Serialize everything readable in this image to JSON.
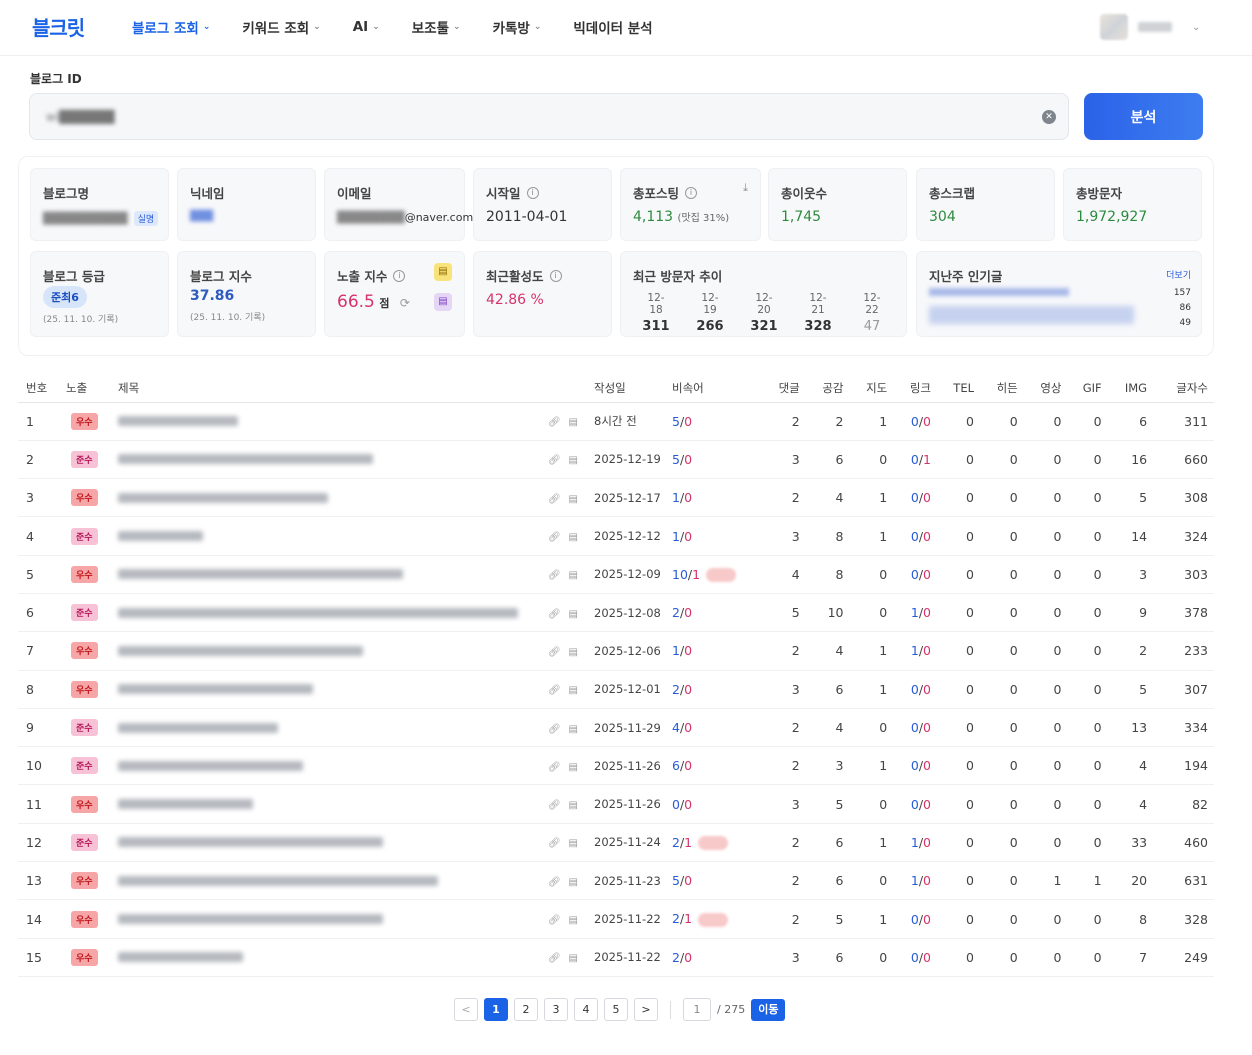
{
  "header": {
    "logo": "블크릿",
    "nav": [
      {
        "label": "블로그 조회",
        "active": true
      },
      {
        "label": "키워드 조회"
      },
      {
        "label": "AI"
      },
      {
        "label": "보조툴"
      },
      {
        "label": "카톡방"
      },
      {
        "label": "빅데이터 분석"
      }
    ]
  },
  "search": {
    "label": "블로그 ID",
    "value": "wi██████",
    "button": "분석"
  },
  "stats": {
    "blog_name": {
      "title": "블로그명",
      "badge": "실명"
    },
    "nickname": {
      "title": "닉네임"
    },
    "email": {
      "title": "이메일",
      "suffix": "@naver.com"
    },
    "start_date": {
      "title": "시작일",
      "value": "2011-04-01"
    },
    "total_posts": {
      "title": "총포스팅",
      "value": "4,113",
      "note": "(맛집 31%)"
    },
    "neighbors": {
      "title": "총이웃수",
      "value": "1,745"
    },
    "scraps": {
      "title": "총스크랩",
      "value": "304"
    },
    "visitors": {
      "title": "총방문자",
      "value": "1,972,927"
    },
    "grade": {
      "title": "블로그 등급",
      "value": "준최6",
      "date": "(25. 11. 10. 기록)"
    },
    "index": {
      "title": "블로그 지수",
      "value": "37.86",
      "date": "(25. 11. 10. 기록)"
    },
    "exposure": {
      "title": "노출 지수",
      "value": "66.5",
      "unit": "점"
    },
    "activity": {
      "title": "최근활성도",
      "value": "42.86 %"
    },
    "recent_visitors": {
      "title": "최근 방문자 추이",
      "days": [
        {
          "date": "12-18",
          "count": "311"
        },
        {
          "date": "12-19",
          "count": "266"
        },
        {
          "date": "12-20",
          "count": "321"
        },
        {
          "date": "12-21",
          "count": "328"
        },
        {
          "date": "12-22",
          "count": "47"
        }
      ]
    },
    "popular": {
      "title": "지난주 인기글",
      "more": "더보기",
      "nums": [
        "157",
        "86",
        "49"
      ]
    }
  },
  "table": {
    "headers": [
      "번호",
      "노출",
      "제목",
      "작성일",
      "비속어",
      "댓글",
      "공감",
      "지도",
      "링크",
      "TEL",
      "히든",
      "영상",
      "GIF",
      "IMG",
      "글자수"
    ],
    "rows": [
      {
        "no": "1",
        "tag": "우수",
        "tw": 120,
        "date": "8시간 전",
        "kwa": "5",
        "kwb": "0",
        "pill": false,
        "c": "2",
        "l": "2",
        "m": "1",
        "la": "0",
        "lb": "0",
        "tel": "0",
        "h": "0",
        "v": "0",
        "g": "0",
        "img": "6",
        "len": "311"
      },
      {
        "no": "2",
        "tag": "준수",
        "tw": 255,
        "date": "2025-12-19",
        "kwa": "5",
        "kwb": "0",
        "pill": false,
        "c": "3",
        "l": "6",
        "m": "0",
        "la": "0",
        "lb": "1",
        "tel": "0",
        "h": "0",
        "v": "0",
        "g": "0",
        "img": "16",
        "len": "660"
      },
      {
        "no": "3",
        "tag": "우수",
        "tw": 210,
        "date": "2025-12-17",
        "kwa": "1",
        "kwb": "0",
        "pill": false,
        "c": "2",
        "l": "4",
        "m": "1",
        "la": "0",
        "lb": "0",
        "tel": "0",
        "h": "0",
        "v": "0",
        "g": "0",
        "img": "5",
        "len": "308"
      },
      {
        "no": "4",
        "tag": "준수",
        "tw": 85,
        "date": "2025-12-12",
        "kwa": "1",
        "kwb": "0",
        "pill": false,
        "c": "3",
        "l": "8",
        "m": "1",
        "la": "0",
        "lb": "0",
        "tel": "0",
        "h": "0",
        "v": "0",
        "g": "0",
        "img": "14",
        "len": "324"
      },
      {
        "no": "5",
        "tag": "우수",
        "tw": 285,
        "date": "2025-12-09",
        "kwa": "10",
        "kwb": "1",
        "pill": true,
        "c": "4",
        "l": "8",
        "m": "0",
        "la": "0",
        "lb": "0",
        "tel": "0",
        "h": "0",
        "v": "0",
        "g": "0",
        "img": "3",
        "len": "303"
      },
      {
        "no": "6",
        "tag": "준수",
        "tw": 400,
        "date": "2025-12-08",
        "kwa": "2",
        "kwb": "0",
        "pill": false,
        "c": "5",
        "l": "10",
        "m": "0",
        "la": "1",
        "lb": "0",
        "tel": "0",
        "h": "0",
        "v": "0",
        "g": "0",
        "img": "9",
        "len": "378"
      },
      {
        "no": "7",
        "tag": "우수",
        "tw": 245,
        "date": "2025-12-06",
        "kwa": "1",
        "kwb": "0",
        "pill": false,
        "c": "2",
        "l": "4",
        "m": "1",
        "la": "1",
        "lb": "0",
        "tel": "0",
        "h": "0",
        "v": "0",
        "g": "0",
        "img": "2",
        "len": "233"
      },
      {
        "no": "8",
        "tag": "우수",
        "tw": 195,
        "date": "2025-12-01",
        "kwa": "2",
        "kwb": "0",
        "pill": false,
        "c": "3",
        "l": "6",
        "m": "1",
        "la": "0",
        "lb": "0",
        "tel": "0",
        "h": "0",
        "v": "0",
        "g": "0",
        "img": "5",
        "len": "307"
      },
      {
        "no": "9",
        "tag": "준수",
        "tw": 160,
        "date": "2025-11-29",
        "kwa": "4",
        "kwb": "0",
        "pill": false,
        "c": "2",
        "l": "4",
        "m": "0",
        "la": "0",
        "lb": "0",
        "tel": "0",
        "h": "0",
        "v": "0",
        "g": "0",
        "img": "13",
        "len": "334"
      },
      {
        "no": "10",
        "tag": "준수",
        "tw": 185,
        "date": "2025-11-26",
        "kwa": "6",
        "kwb": "0",
        "pill": false,
        "c": "2",
        "l": "3",
        "m": "1",
        "la": "0",
        "lb": "0",
        "tel": "0",
        "h": "0",
        "v": "0",
        "g": "0",
        "img": "4",
        "len": "194"
      },
      {
        "no": "11",
        "tag": "우수",
        "tw": 135,
        "date": "2025-11-26",
        "kwa": "0",
        "kwb": "0",
        "pill": false,
        "c": "3",
        "l": "5",
        "m": "0",
        "la": "0",
        "lb": "0",
        "tel": "0",
        "h": "0",
        "v": "0",
        "g": "0",
        "img": "4",
        "len": "82"
      },
      {
        "no": "12",
        "tag": "준수",
        "tw": 265,
        "date": "2025-11-24",
        "kwa": "2",
        "kwb": "1",
        "pill": true,
        "c": "2",
        "l": "6",
        "m": "1",
        "la": "1",
        "lb": "0",
        "tel": "0",
        "h": "0",
        "v": "0",
        "g": "0",
        "img": "33",
        "len": "460"
      },
      {
        "no": "13",
        "tag": "우수",
        "tw": 320,
        "date": "2025-11-23",
        "kwa": "5",
        "kwb": "0",
        "pill": false,
        "c": "2",
        "l": "6",
        "m": "0",
        "la": "1",
        "lb": "0",
        "tel": "0",
        "h": "0",
        "v": "1",
        "g": "1",
        "img": "20",
        "len": "631"
      },
      {
        "no": "14",
        "tag": "우수",
        "tw": 265,
        "date": "2025-11-22",
        "kwa": "2",
        "kwb": "1",
        "pill": true,
        "c": "2",
        "l": "5",
        "m": "1",
        "la": "0",
        "lb": "0",
        "tel": "0",
        "h": "0",
        "v": "0",
        "g": "0",
        "img": "8",
        "len": "328"
      },
      {
        "no": "15",
        "tag": "우수",
        "tw": 125,
        "date": "2025-11-22",
        "kwa": "2",
        "kwb": "0",
        "pill": false,
        "c": "3",
        "l": "6",
        "m": "0",
        "la": "0",
        "lb": "0",
        "tel": "0",
        "h": "0",
        "v": "0",
        "g": "0",
        "img": "7",
        "len": "249"
      }
    ]
  },
  "pagination": {
    "pages": [
      "1",
      "2",
      "3",
      "4",
      "5"
    ],
    "current": "1",
    "prev": "<",
    "next": ">",
    "input": "1",
    "total": "/ 275",
    "go": "이동"
  }
}
